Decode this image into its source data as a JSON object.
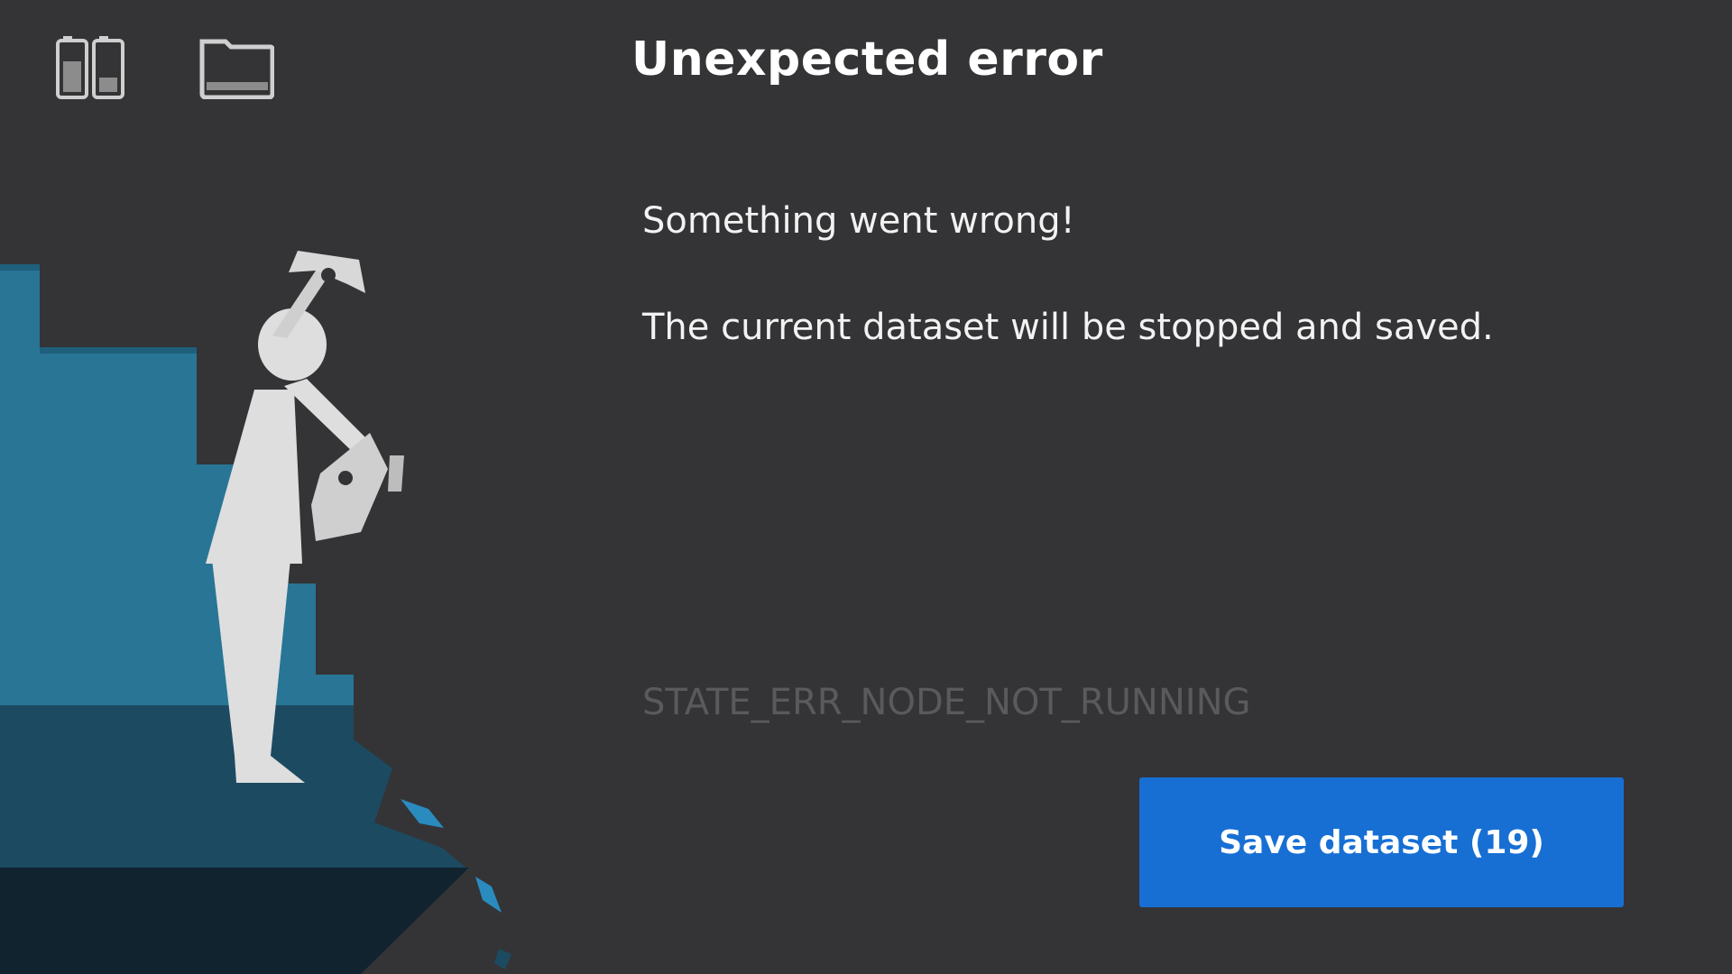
{
  "header": {
    "title": "Unexpected error",
    "icons": [
      "batteries-icon",
      "folder-icon"
    ]
  },
  "dialog": {
    "message_line_1": "Something went wrong!",
    "message_line_2": "The current dataset will be stopped and saved.",
    "error_code": "STATE_ERR_NODE_NOT_RUNNING"
  },
  "actions": {
    "save_label": "Save dataset (19)"
  },
  "colors": {
    "background": "#343436",
    "accent": "#176fd4",
    "cliff_light": "#287596",
    "cliff_mid": "#1c4a61",
    "cliff_dark": "#122330",
    "figure": "#dedede"
  }
}
